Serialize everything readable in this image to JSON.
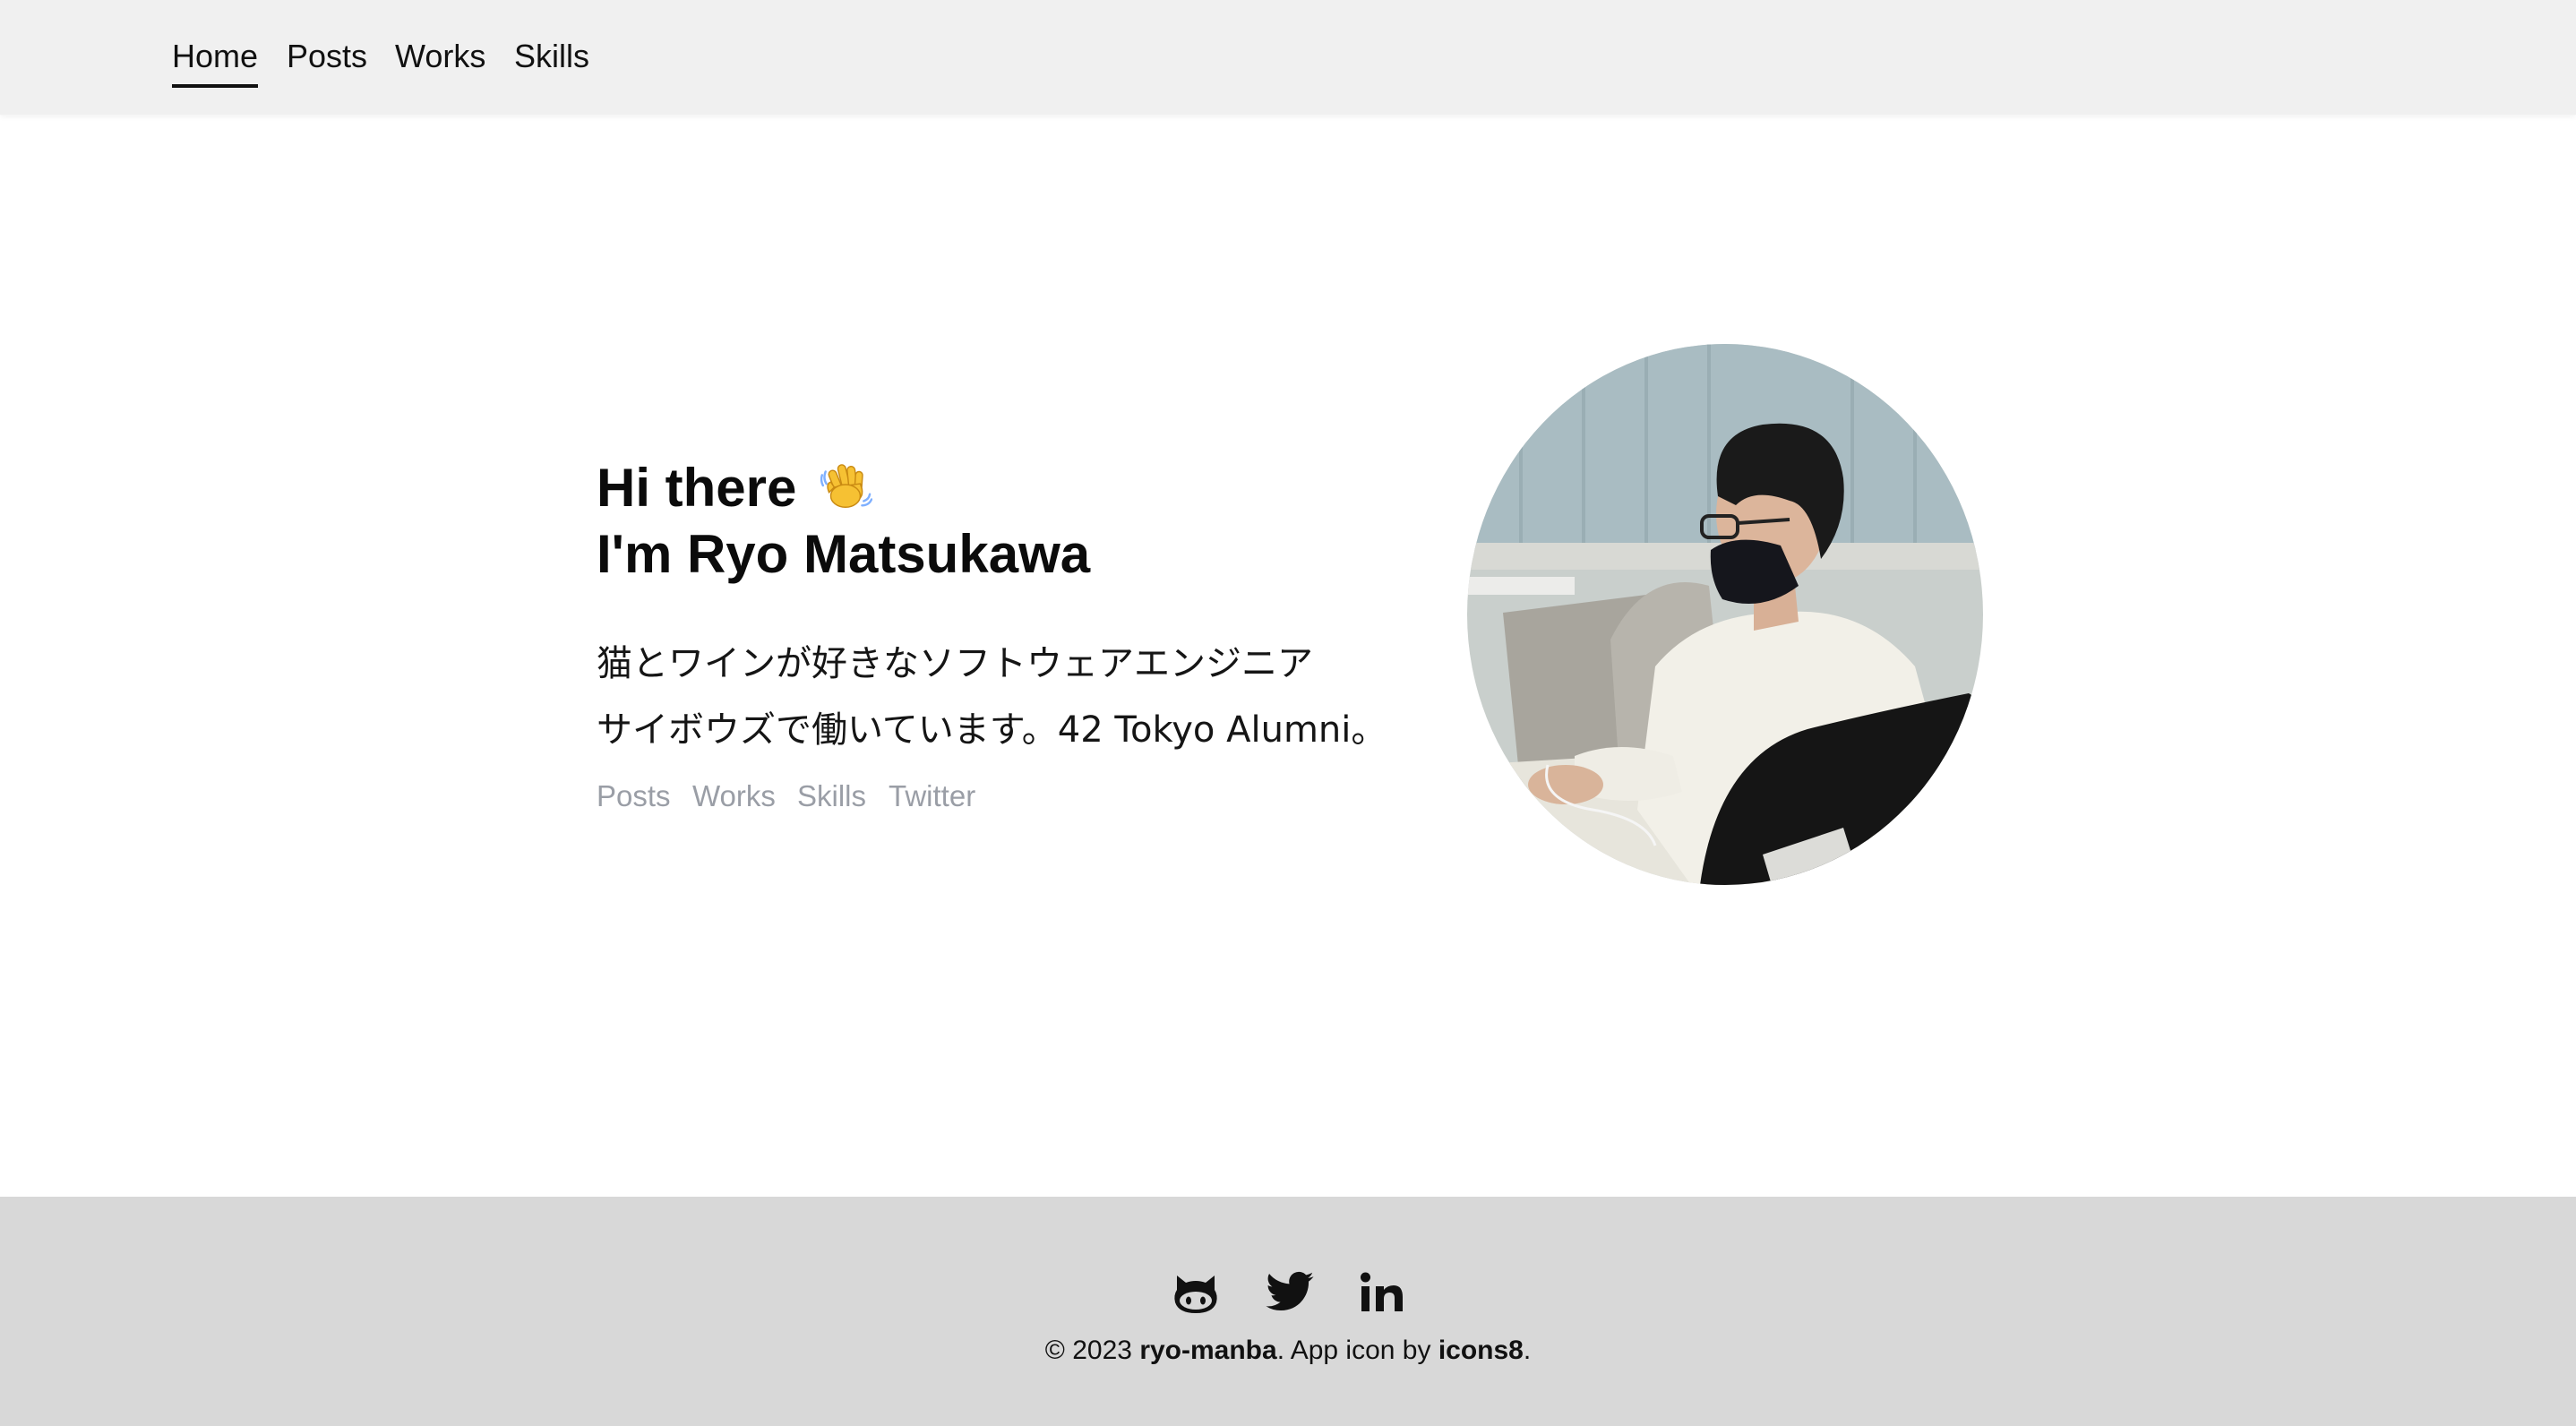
{
  "nav": {
    "items": [
      {
        "label": "Home",
        "active": true
      },
      {
        "label": "Posts",
        "active": false
      },
      {
        "label": "Works",
        "active": false
      },
      {
        "label": "Skills",
        "active": false
      }
    ]
  },
  "hero": {
    "greeting": "Hi there",
    "greeting_emoji": "waving-hand-icon",
    "name_line": "I'm Ryo Matsukawa",
    "bio_line_1": "猫とワインが好きなソフトウェアエンジニア",
    "bio_line_2": "サイボウズで働いています。42 Tokyo Alumni。",
    "links": [
      "Posts",
      "Works",
      "Skills",
      "Twitter"
    ],
    "avatar_alt": "profile-photo"
  },
  "footer": {
    "social_icons": [
      "github-icon",
      "twitter-icon",
      "linkedin-icon"
    ],
    "copyright_prefix": "© 2023 ",
    "author": "ryo-manba",
    "middle": ". App icon by ",
    "icon_credit": "icons8",
    "suffix": "."
  },
  "colors": {
    "nav_bg": "#f0f0f0",
    "footer_bg": "#d8d8d8",
    "link_muted": "#9a9ea6",
    "text": "#0b0b0b"
  }
}
